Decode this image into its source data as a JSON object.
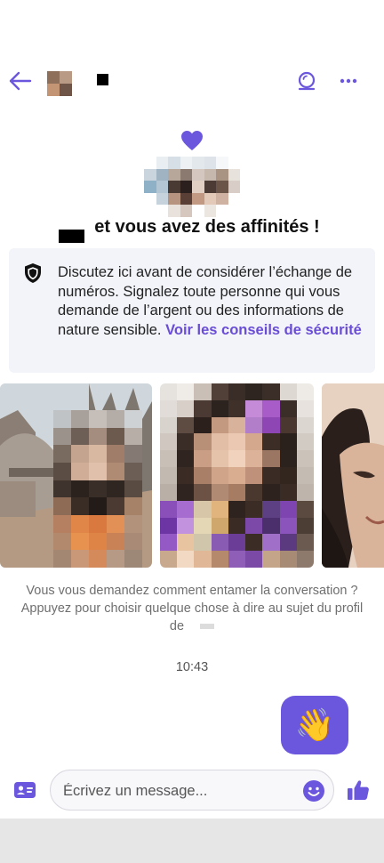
{
  "header": {
    "back_icon": "arrow-left-icon",
    "video_icon": "video-chat-icon",
    "more_icon": "more-dots-icon"
  },
  "match": {
    "heart_icon": "heart-icon",
    "title": "et vous avez des affinités !"
  },
  "safety": {
    "icon": "shield-icon",
    "text": "Discutez ici avant de considérer l’échange de numéros. Signalez toute personne qui vous demande de l’argent ou des informations de nature sensible. ",
    "link": "Voir les conseils de sécurité"
  },
  "conversation": {
    "hint": "Vous vous demandez comment entamer la conversation ? Appuyez pour choisir quelque chose à dire au sujet du profil de",
    "time": "10:43",
    "wave_emoji": "👋"
  },
  "composer": {
    "profile_card_icon": "profile-card-icon",
    "placeholder": "Écrivez un message...",
    "emoji_icon": "smiley-icon",
    "like_icon": "thumbs-up-icon"
  },
  "colors": {
    "accent": "#6b57de",
    "link": "#6a4dd6",
    "notice_bg": "#f2f4f9"
  }
}
